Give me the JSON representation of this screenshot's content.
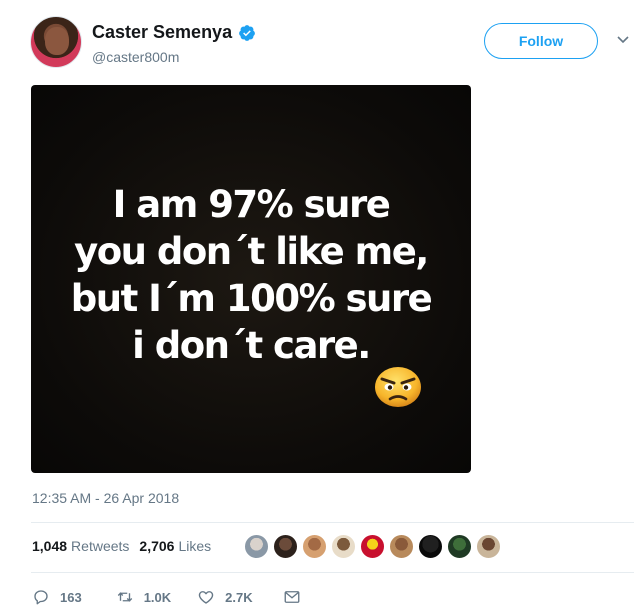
{
  "user": {
    "name": "Caster Semenya",
    "handle": "@caster800m",
    "follow_label": "Follow"
  },
  "media": {
    "lines": [
      "I am 97% sure",
      "you don´t like me,",
      "but I´m 100% sure",
      "i don´t care."
    ],
    "emoji": "angry-face-emoji"
  },
  "timestamp": "12:35 AM - 26 Apr 2018",
  "stats": {
    "retweets_count": "1,048",
    "retweets_label": "Retweets",
    "likes_count": "2,706",
    "likes_label": "Likes"
  },
  "actions": {
    "replies": "163",
    "retweets": "1.0K",
    "likes": "2.7K"
  },
  "colors": {
    "accent": "#1da1f2",
    "muted": "#657786"
  }
}
